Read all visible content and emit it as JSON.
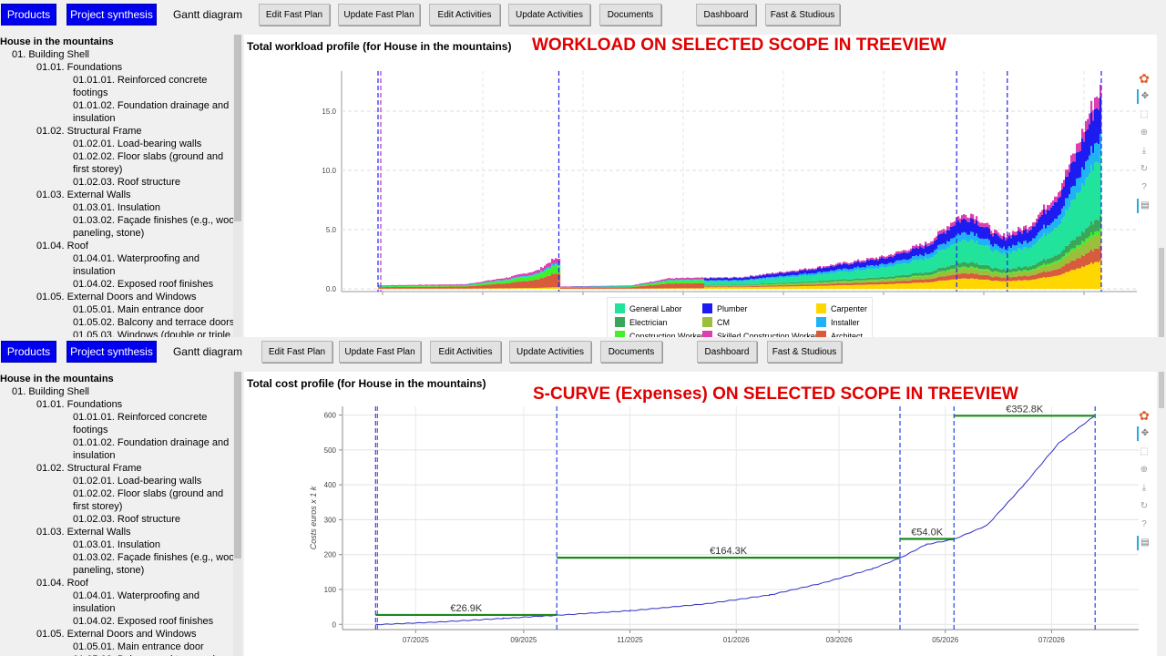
{
  "toolbar": {
    "products": "Products",
    "project_synthesis": "Project synthesis",
    "gantt": "Gantt diagram",
    "edit_fast_plan": "Edit Fast Plan",
    "update_fast_plan": "Update Fast Plan",
    "edit_activities": "Edit Activities",
    "update_activities": "Update Activities",
    "documents": "Documents",
    "dashboard": "Dashboard",
    "fast_studious": "Fast & Studious"
  },
  "tree": {
    "items": [
      {
        "label": "House in the mountains",
        "level": 0
      },
      {
        "label": "01. Building Shell",
        "level": 1
      },
      {
        "label": "01.01. Foundations",
        "level": 2
      },
      {
        "label": "01.01.01. Reinforced concrete",
        "level": 3
      },
      {
        "label": "footings",
        "level": 3
      },
      {
        "label": "01.01.02. Foundation drainage and",
        "level": 3
      },
      {
        "label": "insulation",
        "level": 3
      },
      {
        "label": "01.02. Structural Frame",
        "level": 2
      },
      {
        "label": "01.02.01. Load-bearing walls",
        "level": 3
      },
      {
        "label": "01.02.02. Floor slabs (ground and",
        "level": 3
      },
      {
        "label": "first storey)",
        "level": 3
      },
      {
        "label": "01.02.03. Roof structure",
        "level": 3
      },
      {
        "label": "01.03. External Walls",
        "level": 2
      },
      {
        "label": "01.03.01. Insulation",
        "level": 3
      },
      {
        "label": "01.03.02. Façade finishes (e.g., wood",
        "level": 3
      },
      {
        "label": "paneling, stone)",
        "level": 3
      },
      {
        "label": "01.04. Roof",
        "level": 2
      },
      {
        "label": "01.04.01. Waterproofing and",
        "level": 3
      },
      {
        "label": "insulation",
        "level": 3
      },
      {
        "label": "01.04.02. Exposed roof finishes",
        "level": 3
      },
      {
        "label": "01.05. External Doors and Windows",
        "level": 2
      },
      {
        "label": "01.05.01. Main entrance door",
        "level": 3
      },
      {
        "label": "01.05.02. Balcony and terrace doors",
        "level": 3
      },
      {
        "label": "01.05.03. Windows (double or triple",
        "level": 3
      }
    ]
  },
  "workload_chart": {
    "title": "Total workload profile (for House in the mountains)",
    "annotation": "WORKLOAD ON SELECTED SCOPE IN TREEVIEW",
    "annotation_color": "#e00000"
  },
  "cost_chart": {
    "title": "Total cost profile (for House in the mountains)",
    "annotation": "S-CURVE (Expenses) ON SELECTED SCOPE IN TREEVIEW",
    "annotation_color": "#e00000"
  },
  "chart_tools": [
    "bokeh-logo-icon",
    "pan-icon",
    "box-zoom-icon",
    "wheel-zoom-icon",
    "save-icon",
    "reset-icon",
    "help-icon",
    "hover-icon"
  ],
  "chart_data": [
    {
      "type": "area",
      "title": "Total workload profile (for House in the mountains)",
      "ylim": [
        0,
        18
      ],
      "yticks": [
        "0.0",
        "5.0",
        "10.0",
        "15.0"
      ],
      "xlabel": "",
      "ylabel": "",
      "legend_position": "bottom",
      "series": [
        {
          "name": "General Labor",
          "color": "#22e39c"
        },
        {
          "name": "Plumber",
          "color": "#1c1cf0"
        },
        {
          "name": "Carpenter",
          "color": "#ffd700"
        },
        {
          "name": "Electrician",
          "color": "#3aa65a"
        },
        {
          "name": "CM",
          "color": "#9bbf3b"
        },
        {
          "name": "Installer",
          "color": "#1fb2f5"
        },
        {
          "name": "Construction Worker",
          "color": "#41f02a"
        },
        {
          "name": "Skilled Construction Worker",
          "color": "#dd3fb0"
        },
        {
          "name": "Architect",
          "color": "#d85c3c"
        }
      ],
      "total_profile": [
        {
          "x": 0.0,
          "y": 0.3
        },
        {
          "x": 0.12,
          "y": 0.4
        },
        {
          "x": 0.18,
          "y": 1.0
        },
        {
          "x": 0.22,
          "y": 1.6
        },
        {
          "x": 0.24,
          "y": 2.5
        },
        {
          "x": 0.25,
          "y": 2.6
        },
        {
          "x": 0.25,
          "y": 0.2
        },
        {
          "x": 0.35,
          "y": 0.3
        },
        {
          "x": 0.4,
          "y": 0.9
        },
        {
          "x": 0.5,
          "y": 1.0
        },
        {
          "x": 0.6,
          "y": 1.8
        },
        {
          "x": 0.7,
          "y": 2.8
        },
        {
          "x": 0.76,
          "y": 4.0
        },
        {
          "x": 0.8,
          "y": 6.2
        },
        {
          "x": 0.82,
          "y": 6.5
        },
        {
          "x": 0.86,
          "y": 4.5
        },
        {
          "x": 0.9,
          "y": 5.5
        },
        {
          "x": 0.94,
          "y": 8.5
        },
        {
          "x": 0.97,
          "y": 13.0
        },
        {
          "x": 0.99,
          "y": 16.5
        },
        {
          "x": 1.0,
          "y": 17.3
        }
      ],
      "vlines": [
        0.0,
        0.25,
        0.8,
        0.87,
        1.0
      ]
    },
    {
      "type": "line",
      "title": "Total cost profile (for House in the mountains)",
      "xlabel": "",
      "ylabel": "Costs euros x 1 k",
      "ylim": [
        -15,
        625
      ],
      "yticks": [
        0,
        100,
        200,
        300,
        400,
        500,
        600
      ],
      "xlim": [
        "2025-05-20",
        "2026-08-20"
      ],
      "xticks": [
        "07/2025",
        "09/2025",
        "11/2025",
        "01/2026",
        "03/2026",
        "05/2026",
        "07/2026"
      ],
      "s_curve": [
        {
          "x": "2025-06-08",
          "y": 0
        },
        {
          "x": "2025-07-15",
          "y": 8
        },
        {
          "x": "2025-08-20",
          "y": 18
        },
        {
          "x": "2025-09-20",
          "y": 27
        },
        {
          "x": "2025-11-01",
          "y": 40
        },
        {
          "x": "2025-12-15",
          "y": 60
        },
        {
          "x": "2026-01-20",
          "y": 85
        },
        {
          "x": "2026-02-20",
          "y": 120
        },
        {
          "x": "2026-03-20",
          "y": 160
        },
        {
          "x": "2026-04-05",
          "y": 191
        },
        {
          "x": "2026-04-20",
          "y": 230
        },
        {
          "x": "2026-05-06",
          "y": 245
        },
        {
          "x": "2026-05-25",
          "y": 285
        },
        {
          "x": "2026-06-15",
          "y": 400
        },
        {
          "x": "2026-07-05",
          "y": 520
        },
        {
          "x": "2026-07-26",
          "y": 600
        }
      ],
      "phases": [
        {
          "x0": "2025-06-08",
          "x1": "2025-09-20",
          "y": 27,
          "label": "€26.9K"
        },
        {
          "x0": "2025-09-20",
          "x1": "2026-04-05",
          "y": 191,
          "label": "€164.3K"
        },
        {
          "x0": "2026-04-05",
          "x1": "2026-05-06",
          "y": 245,
          "label": "€54.0K"
        },
        {
          "x0": "2026-05-06",
          "x1": "2026-07-26",
          "y": 598,
          "label": "€352.8K"
        }
      ],
      "vlines": [
        "2025-06-08",
        "2025-09-20",
        "2026-04-05",
        "2026-05-06",
        "2026-07-26"
      ]
    }
  ]
}
